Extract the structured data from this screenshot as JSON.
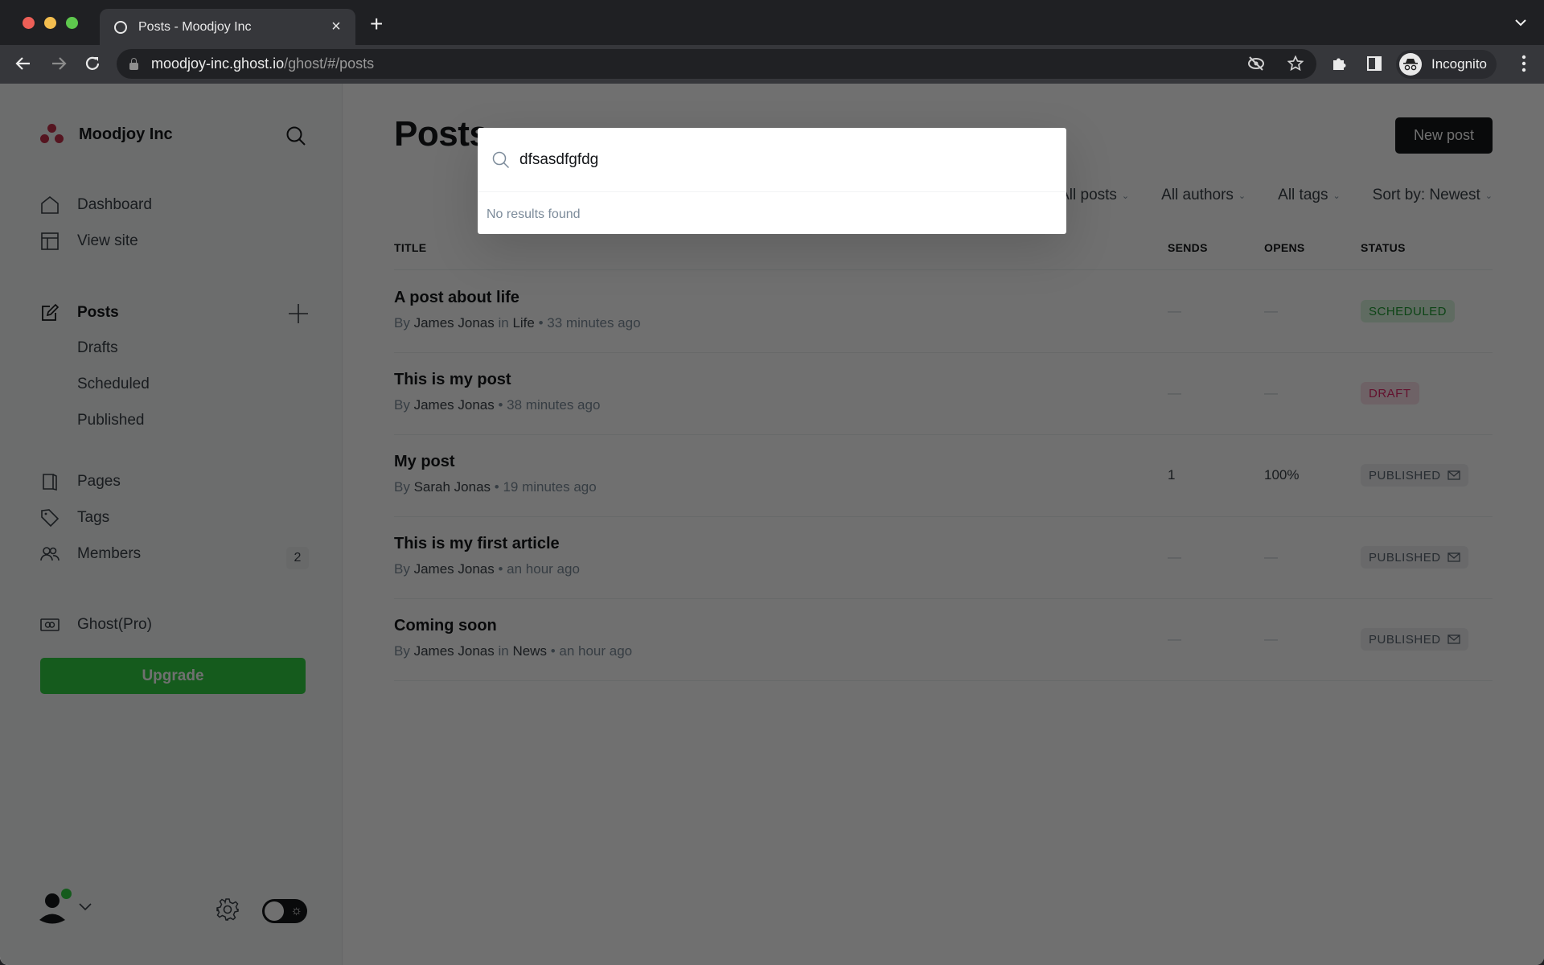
{
  "browser": {
    "tab_title": "Posts - Moodjoy Inc",
    "url_host": "moodjoy-inc.ghost.io",
    "url_path": "/ghost/#/posts",
    "profile_label": "Incognito"
  },
  "sidebar": {
    "site_name": "Moodjoy Inc",
    "nav": [
      {
        "label": "Dashboard",
        "icon": "home-icon"
      },
      {
        "label": "View site",
        "icon": "layout-icon"
      }
    ],
    "posts": {
      "label": "Posts",
      "icon": "edit-icon"
    },
    "post_subitems": [
      "Drafts",
      "Scheduled",
      "Published"
    ],
    "content_nav": [
      {
        "label": "Pages",
        "icon": "pages-icon"
      },
      {
        "label": "Tags",
        "icon": "tag-icon"
      },
      {
        "label": "Members",
        "icon": "members-icon",
        "count": "2"
      }
    ],
    "ghost_pro": {
      "label": "Ghost(Pro)",
      "icon": "ghost-pro-icon"
    },
    "upgrade_label": "Upgrade",
    "brand_color": "#c2304a",
    "upgrade_color": "#30cf43"
  },
  "main": {
    "title": "Posts",
    "new_post_label": "New post",
    "filters": [
      "All posts",
      "All authors",
      "All tags",
      "Sort by: Newest"
    ],
    "columns": {
      "title": "TITLE",
      "sends": "SENDS",
      "opens": "OPENS",
      "status": "STATUS"
    },
    "posts": [
      {
        "title": "A post about life",
        "by": "By",
        "author": "James Jonas",
        "in": "in",
        "tag": "Life",
        "time": "33 minutes ago",
        "sends": "—",
        "opens": "—",
        "status": "SCHEDULED"
      },
      {
        "title": "This is my post",
        "by": "By",
        "author": "James Jonas",
        "in": "",
        "tag": "",
        "time": "38 minutes ago",
        "sends": "—",
        "opens": "—",
        "status": "DRAFT"
      },
      {
        "title": "My post",
        "by": "By",
        "author": "Sarah Jonas",
        "in": "",
        "tag": "",
        "time": "19 minutes ago",
        "sends": "1",
        "opens": "100%",
        "status": "PUBLISHED"
      },
      {
        "title": "This is my first article",
        "by": "By",
        "author": "James Jonas",
        "in": "",
        "tag": "",
        "time": "an hour ago",
        "sends": "—",
        "opens": "—",
        "status": "PUBLISHED"
      },
      {
        "title": "Coming soon",
        "by": "By",
        "author": "James Jonas",
        "in": "in",
        "tag": "News",
        "time": "an hour ago",
        "sends": "—",
        "opens": "—",
        "status": "PUBLISHED"
      }
    ]
  },
  "search": {
    "query": "dfsasdfgfdg",
    "empty_message": "No results found"
  }
}
